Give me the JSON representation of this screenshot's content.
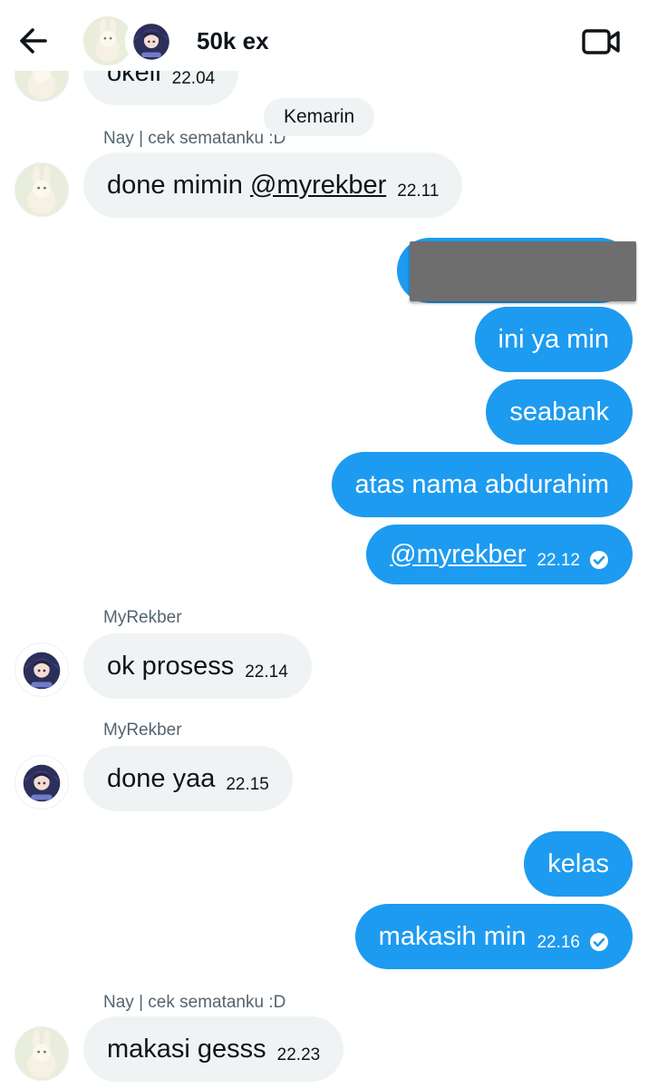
{
  "header": {
    "title": "50k ex",
    "back_icon": "arrow-left-icon",
    "video_icon": "video-camera-icon"
  },
  "date_separator": "Kemarin",
  "messages": [
    {
      "side": "in",
      "text": "okeii",
      "time": "22.04"
    },
    {
      "side": "in",
      "sender": "Nay | cek sematanku :D",
      "text": "done mimin ",
      "mention": "@myrekber",
      "time": "22.11"
    },
    {
      "side": "out",
      "text": "",
      "redacted": true
    },
    {
      "side": "out",
      "text": "ini ya min"
    },
    {
      "side": "out",
      "text": "seabank"
    },
    {
      "side": "out",
      "text": "atas nama abdurahim"
    },
    {
      "side": "out",
      "mention": "@myrekber",
      "time": "22.12",
      "read": true
    },
    {
      "side": "in",
      "sender": "MyRekber",
      "text": "ok prosess",
      "time": "22.14"
    },
    {
      "side": "in",
      "sender": "MyRekber",
      "text": "done yaa",
      "time": "22.15"
    },
    {
      "side": "out",
      "text": "kelas"
    },
    {
      "side": "out",
      "text": "makasih min",
      "time": "22.16",
      "read": true
    },
    {
      "side": "in",
      "sender": "Nay | cek sematanku :D",
      "text": "makasi gesss",
      "time": "22.23"
    }
  ],
  "colors": {
    "outgoing_bubble": "#1d9bf0",
    "incoming_bubble": "#eff3f4",
    "sender_text": "#536471"
  }
}
